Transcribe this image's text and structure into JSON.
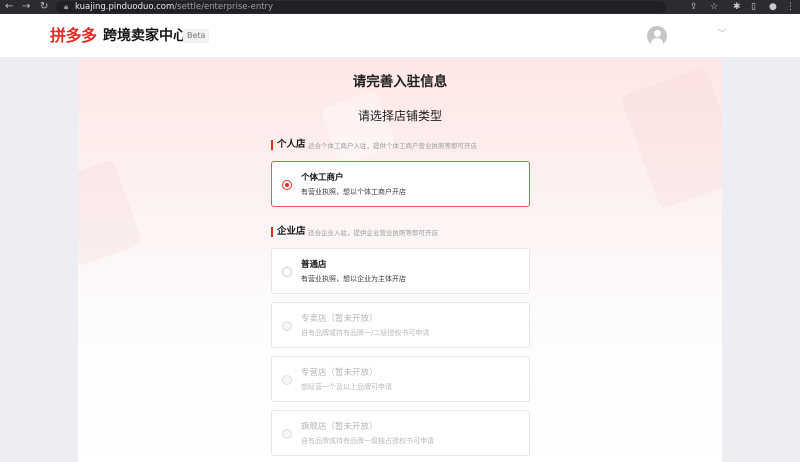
{
  "browser": {
    "url_host": "kuajing.pinduoduo.com",
    "url_path": "/settle/enterprise-entry"
  },
  "header": {
    "logo_text": "拼多多",
    "title": "跨境卖家中心",
    "badge": "Beta"
  },
  "page": {
    "title": "请完善入驻信息",
    "subtitle": "请选择店铺类型"
  },
  "sections": {
    "personal": {
      "name": "个人店",
      "desc": "适合个体工商户入驻，提供个体工商户营业执照等即可开店"
    },
    "enterprise": {
      "name": "企业店",
      "desc": "适合企业入驻，提供企业营业执照等即可开店"
    }
  },
  "options": [
    {
      "title": "个体工商户",
      "desc": "有营业执照，想以个体工商户开店",
      "selected": true,
      "disabled": false
    },
    {
      "title": "普通店",
      "desc": "有营业执照，想以企业为主体开店",
      "selected": false,
      "disabled": false
    },
    {
      "title": "专卖店（暂未开放）",
      "desc": "自有品牌或持有品牌一/二级授权书可申请",
      "selected": false,
      "disabled": true
    },
    {
      "title": "专营店（暂未开放）",
      "desc": "想经营一个及以上品牌可申请",
      "selected": false,
      "disabled": true
    },
    {
      "title": "旗舰店（暂未开放）",
      "desc": "自有品牌或持有品牌一级独占授权书可申请",
      "selected": false,
      "disabled": true
    }
  ],
  "colors": {
    "brand": "#e02e24",
    "selected_border": "#e5575d"
  }
}
